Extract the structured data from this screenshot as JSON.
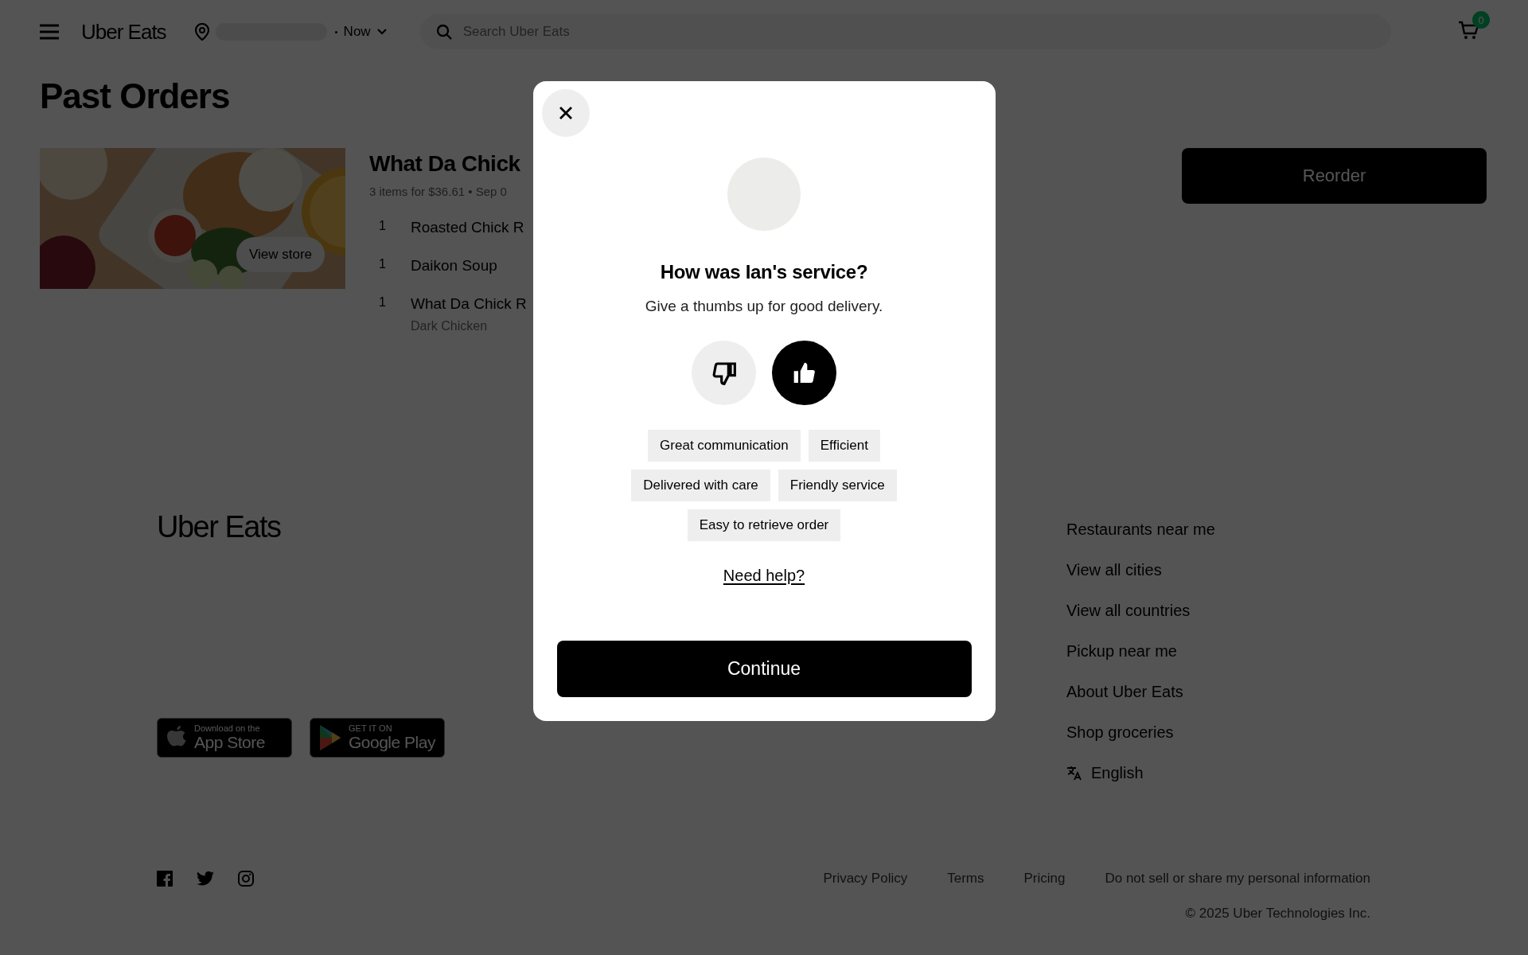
{
  "header": {
    "logo": "Uber Eats",
    "time": "Now",
    "search": {
      "placeholder": "Search Uber Eats"
    },
    "cart_count": "0"
  },
  "page_title": "Past Orders",
  "orders": [
    {
      "store": "What Da Chick",
      "summary": "3 items for $36.61 • Sep 0",
      "view_store": "View store",
      "image": {
        "kind": "picture"
      },
      "items": [
        {
          "qty": "1",
          "name": "Roasted Chick R"
        },
        {
          "qty": "1",
          "name": "Daikon Soup"
        },
        {
          "qty": "1",
          "name": "What Da Chick R",
          "note": "Dark Chicken"
        }
      ],
      "reorder": "Reorder"
    }
  ],
  "footer": {
    "logo": "Uber Eats",
    "app_badges": [
      {
        "kind": "apple",
        "small": "Download on the",
        "big": "App Store"
      },
      {
        "kind": "google",
        "small": "GET IT ON",
        "big": "Google Play"
      }
    ],
    "links": [
      "Restaurants near me",
      "View all cities",
      "View all countries",
      "Pickup near me",
      "About Uber Eats",
      "Shop groceries"
    ],
    "language": "English",
    "social": [
      {
        "kind": "facebook"
      },
      {
        "kind": "twitter"
      },
      {
        "kind": "instagram"
      }
    ],
    "legal_links": [
      "Privacy Policy",
      "Terms",
      "Pricing",
      "Do not sell or share my personal information"
    ],
    "copyright": "© 2025 Uber Technologies Inc."
  },
  "modal": {
    "title": "How was Ian's service?",
    "subtitle": "Give a thumbs up for good delivery.",
    "ratings": [
      {
        "kind": "down",
        "selected": false
      },
      {
        "kind": "up",
        "selected": true
      }
    ],
    "tag_rows": [
      [
        {
          "label": "Great communication",
          "selected": false
        },
        {
          "label": "Efficient",
          "selected": false
        }
      ],
      [
        {
          "label": "Delivered with care",
          "selected": false
        },
        {
          "label": "Friendly service",
          "selected": false
        }
      ],
      [
        {
          "label": "Easy to retrieve order",
          "selected": false
        }
      ]
    ],
    "help_link": "Need help?",
    "continue": "Continue"
  }
}
